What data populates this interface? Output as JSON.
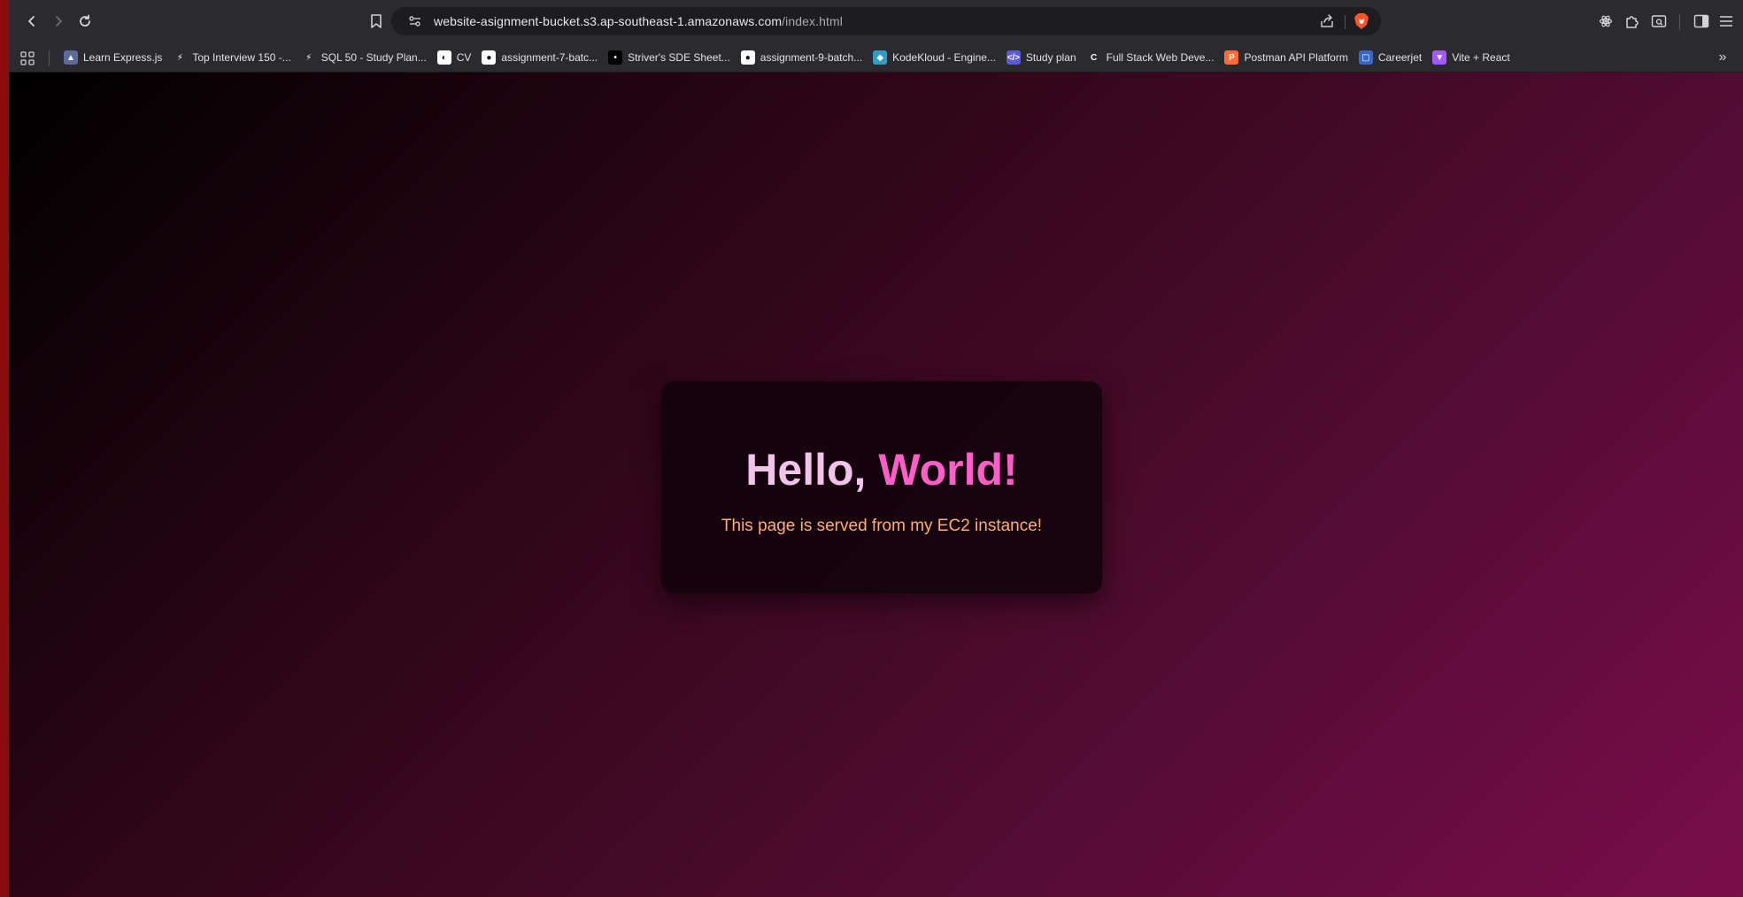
{
  "browser": {
    "url_host": "website-asignment-bucket.s3.ap-southeast-1.amazonaws.com",
    "url_path": "/index.html",
    "icons": {
      "back": "arrow-left-icon",
      "forward": "arrow-right-icon",
      "reload": "reload-icon",
      "bookmark_page": "bookmark-icon",
      "site_info": "site-settings-icon",
      "share": "share-icon",
      "brave_shield": "brave-lion-icon",
      "extensions_left": "atom-icon",
      "extensions": "puzzle-icon",
      "tab_search": "tab-search-icon",
      "sidebar": "sidebar-icon",
      "menu": "hamburger-menu-icon",
      "apps": "apps-grid-icon",
      "bookmarks_overflow": "chevron-double-right-icon"
    }
  },
  "bookmarks": [
    {
      "label": "Learn Express.js",
      "icon_color": "#5b6b9a",
      "glyph": "▲"
    },
    {
      "label": "Top Interview 150 -...",
      "icon_color": "#2b2b2f",
      "glyph": "⚡"
    },
    {
      "label": "SQL 50 - Study Plan...",
      "icon_color": "#2b2b2f",
      "glyph": "⚡"
    },
    {
      "label": "CV",
      "icon_color": "#ffffff",
      "glyph": "◐"
    },
    {
      "label": "assignment-7-batc...",
      "icon_color": "#ffffff",
      "glyph": "●"
    },
    {
      "label": "Striver's SDE Sheet...",
      "icon_color": "#000000",
      "glyph": "•"
    },
    {
      "label": "assignment-9-batch...",
      "icon_color": "#ffffff",
      "glyph": "●"
    },
    {
      "label": "KodeKloud - Engine...",
      "icon_color": "#2ea0c8",
      "glyph": "◆"
    },
    {
      "label": "Study plan",
      "icon_color": "#5b5bd6",
      "glyph": "</>"
    },
    {
      "label": "Full Stack Web Deve...",
      "icon_color": "#2b2b2f",
      "glyph": "C"
    },
    {
      "label": "Postman API Platform",
      "icon_color": "#ff6c37",
      "glyph": "P"
    },
    {
      "label": "Careerjet",
      "icon_color": "#3a66c4",
      "glyph": "▢"
    },
    {
      "label": "Vite + React",
      "icon_color": "#a259ff",
      "glyph": "▼"
    }
  ],
  "page": {
    "headline_part1": "Hello, ",
    "headline_part2": "World!",
    "subtext": "This page is served from my EC2 instance!"
  },
  "colors": {
    "headline_hello": "#f3c4ea",
    "headline_world": "#ff5ec8",
    "subtext": "#ffad74"
  }
}
